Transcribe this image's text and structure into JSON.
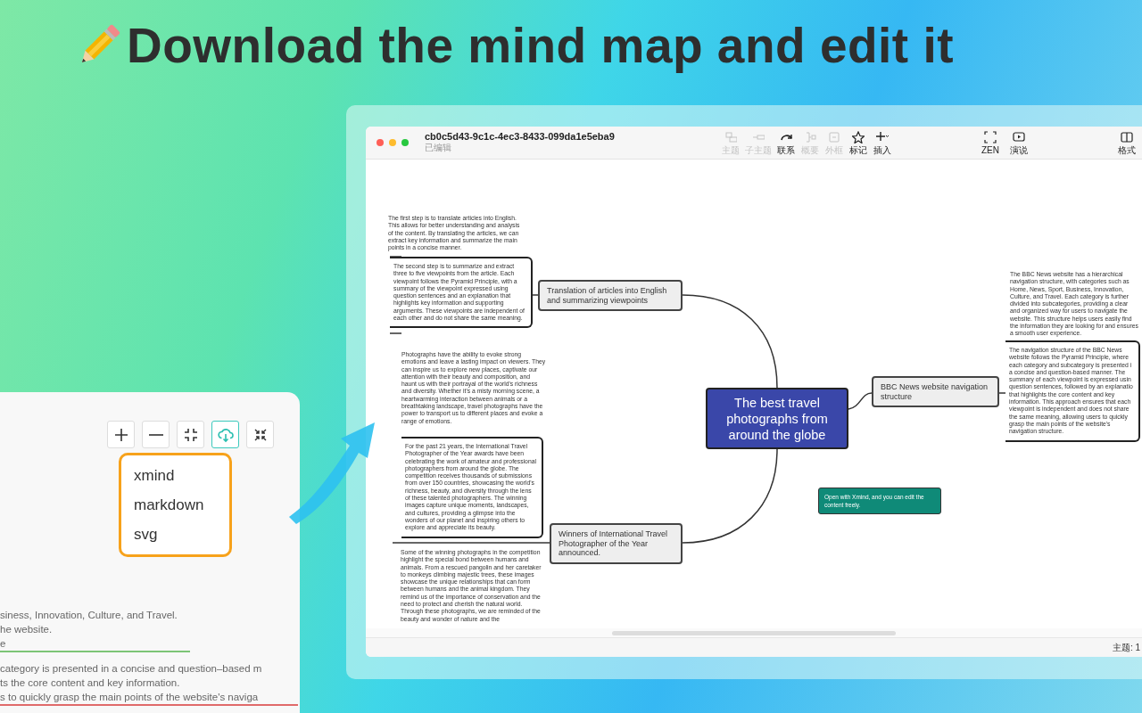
{
  "headline": "Download the mind map and edit it",
  "side_panel": {
    "tools": [
      {
        "selected": false
      },
      {
        "selected": false
      },
      {
        "selected": false
      },
      {
        "selected": true
      },
      {
        "selected": false
      }
    ],
    "export_menu": [
      "xmind",
      "markdown",
      "svg"
    ],
    "text_lines": [
      {
        "text": "siness, Innovation, Culture, and Travel."
      },
      {
        "text": "he website."
      },
      {
        "text": "e",
        "color": "#7cc576"
      },
      {
        "text": "category is presented in a concise and question–based m"
      },
      {
        "text": "ts the core content and key information."
      },
      {
        "text": "s to quickly grasp the main points of the website's naviga",
        "color": "#e06a6a"
      }
    ]
  },
  "window": {
    "title": "cb0c5d43-9c1c-4ec3-8433-099da1e5eba9",
    "subtitle": "已编辑",
    "toolbar": [
      {
        "label": "主题",
        "disabled": true
      },
      {
        "label": "子主题",
        "disabled": true
      },
      {
        "label": "联系",
        "disabled": false
      },
      {
        "label": "概要",
        "disabled": true
      },
      {
        "label": "外框",
        "disabled": true
      },
      {
        "label": "标记",
        "disabled": false
      },
      {
        "label": "插入",
        "disabled": false
      }
    ],
    "view_toolbar": [
      {
        "label": "ZEN",
        "disabled": false
      },
      {
        "label": "演说",
        "disabled": false
      }
    ],
    "format_button": {
      "label": "格式"
    },
    "status_bar": "主题: 1"
  },
  "mind_map": {
    "nodes": [
      {
        "kind": "note",
        "text": "The first step is to translate articles into English. This allows for better understanding and analysis of the content. By translating the articles, we can extract key information and summarize the main points in a concise manner."
      },
      {
        "kind": "note-box",
        "text": "The second step is to summarize and extract three to five viewpoints from the article. Each viewpoint follows the Pyramid Principle, with a summary of the viewpoint expressed using question sentences and an explanation that highlights key information and supporting arguments. These viewpoints are independent of each other and do not share the same meaning."
      },
      {
        "kind": "topic",
        "text": "Translation of articles into English and summarizing viewpoints"
      },
      {
        "kind": "note",
        "text": "Photographs have the ability to evoke strong emotions and leave a lasting impact on viewers. They can inspire us to explore new places, captivate our attention with their beauty and composition, and haunt us with their portrayal of the world's richness and diversity. Whether it's a misty morning scene, a heartwarming interaction between animals or a breathtaking landscape, travel photographs have the power to transport us to different places and evoke a range of emotions."
      },
      {
        "kind": "note-box",
        "text": "For the past 21 years, the International Travel Photographer of the Year awards have been celebrating the work of amateur and professional photographers from around the globe. The competition receives thousands of submissions from over 150 countries, showcasing the world's richness, beauty, and diversity through the lens of these talented photographers. The winning images capture unique moments, landscapes, and cultures, providing a glimpse into the wonders of our planet and inspiring others to explore and appreciate its beauty."
      },
      {
        "kind": "topic",
        "text": "Winners of International Travel Photographer of the Year announced."
      },
      {
        "kind": "note",
        "text": "Some of the winning photographs in the competition highlight the special bond between humans and animals. From a rescued pangolin and her caretaker to monkeys climbing majestic trees, these images showcase the unique relationships that can form between humans and the animal kingdom. They remind us of the importance of conservation and the need to protect and cherish the natural world. Through these photographs, we are reminded of the beauty and wonder of nature and the"
      },
      {
        "kind": "central",
        "text": "The best travel photographs from around the globe"
      },
      {
        "kind": "topic",
        "text": "BBC News website navigation structure"
      },
      {
        "kind": "note",
        "text": "The BBC News website has a hierarchical navigation structure, with categories such as Home, News, Sport, Business, Innovation, Culture, and Travel. Each category is further divided into subcategories, providing a clear and organized way for users to navigate the website. This structure helps users easily find the information they are looking for and ensures a smooth user experience."
      },
      {
        "kind": "note-box",
        "text": "The navigation structure of the BBC News website follows the Pyramid Principle, where each category and subcategory is presented i a concise and question-based manner. The summary of each viewpoint is expressed usin question sentences, followed by an explanatio that highlights the core content and key information. This approach ensures that each viewpoint is independent and does not share the same meaning, allowing users to quickly grasp the main points of the website's navigation structure."
      },
      {
        "kind": "callout",
        "text": "Open with Xmind, and you can edit the content freely."
      }
    ]
  }
}
